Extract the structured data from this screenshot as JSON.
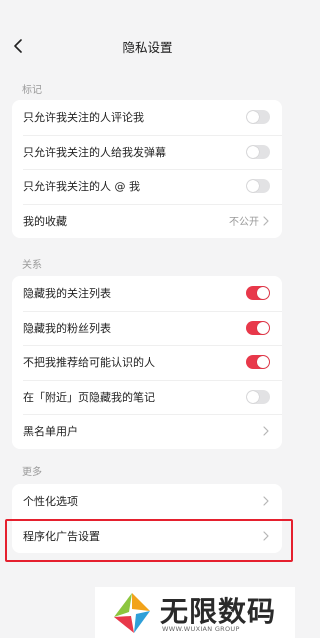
{
  "header": {
    "title": "隐私设置",
    "back_icon": "chevron-left-icon"
  },
  "sections": {
    "tags": {
      "label": "标记",
      "items": [
        {
          "label": "只允许我关注的人评论我",
          "toggle": "off"
        },
        {
          "label": "只允许我关注的人给我发弹幕",
          "toggle": "off"
        },
        {
          "label": "只允许我关注的人 @ 我",
          "toggle": "off"
        },
        {
          "label": "我的收藏",
          "value": "不公开"
        }
      ]
    },
    "relations": {
      "label": "关系",
      "items": [
        {
          "label": "隐藏我的关注列表",
          "toggle": "on"
        },
        {
          "label": "隐藏我的粉丝列表",
          "toggle": "on"
        },
        {
          "label": "不把我推荐给可能认识的人",
          "toggle": "on"
        },
        {
          "label": "在「附近」页隐藏我的笔记",
          "toggle": "off"
        },
        {
          "label": "黑名单用户"
        }
      ]
    },
    "more": {
      "label": "更多",
      "items": [
        {
          "label": "个性化选项"
        },
        {
          "label": "程序化广告设置"
        }
      ]
    }
  },
  "watermark": {
    "text": "无限数码",
    "sub": "WWW.WUXIAN GROUP"
  },
  "colors": {
    "accent": "#e8384a",
    "highlight": "#e5202e",
    "background": "#f4f4f5"
  }
}
